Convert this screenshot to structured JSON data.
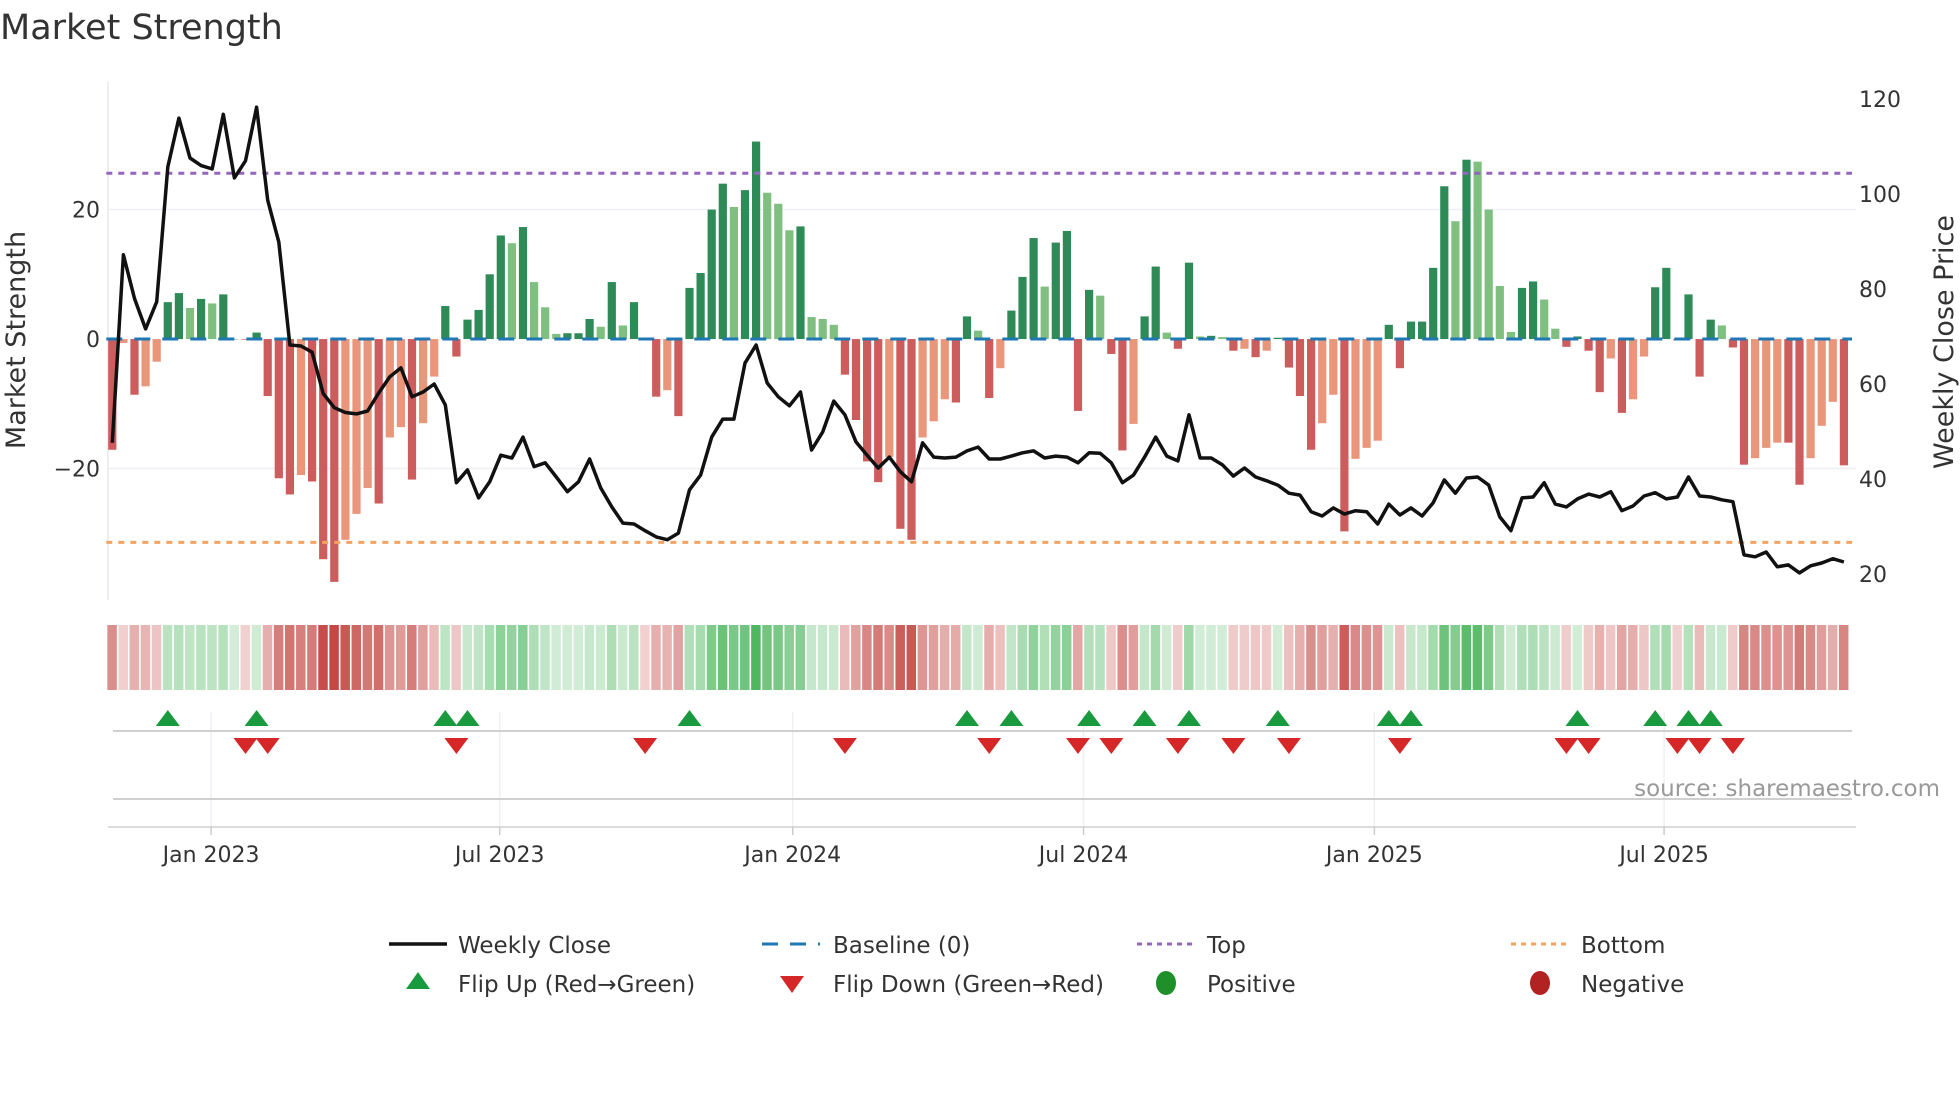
{
  "chart_data": {
    "type": "bar",
    "title": "Market Strength",
    "ylabel": "Market Strength",
    "y2label": "Weekly Close Price",
    "ylim": [
      -40.3,
      39.7
    ],
    "y2lim": [
      14.5,
      123.6
    ],
    "yticks": [
      "20",
      "0",
      "−20"
    ],
    "yticks_values": [
      20,
      0,
      -20
    ],
    "y2ticks": [
      "120",
      "100",
      "80",
      "60",
      "40",
      "20"
    ],
    "y2ticks_values": [
      120,
      100,
      80,
      60,
      40,
      20
    ],
    "xticks": [
      "Jan 2023",
      "Jul 2023",
      "Jan 2024",
      "Jul 2024",
      "Jan 2025",
      "Jul 2025"
    ],
    "top_level": 25.6,
    "bottom_level": -31.4,
    "baseline": 0,
    "strength": [
      -17.1,
      -0.6,
      -8.6,
      -7.3,
      -3.5,
      5.7,
      7.1,
      4.8,
      6.2,
      5.5,
      6.9,
      0,
      -0.1,
      1.0,
      -8.8,
      -21.5,
      -24,
      -21,
      -22,
      -34,
      -37.5,
      -31,
      -27,
      -23,
      -25.4,
      -15.2,
      -13.6,
      -21.7,
      -13,
      -5.8,
      5.1,
      -2.7,
      3.0,
      4.5,
      10,
      16,
      14.8,
      17.3,
      8.8,
      4.9,
      0.8,
      0.9,
      0.9,
      3.1,
      1.9,
      8.8,
      2.1,
      5.7,
      -0.1,
      -8.9,
      -7.9,
      -11.9,
      7.9,
      10.2,
      20,
      24,
      20.4,
      23,
      30.5,
      22.6,
      20.9,
      16.8,
      17.4,
      3.4,
      3.1,
      2.2,
      -5.5,
      -12.5,
      -18.9,
      -22.1,
      -18.2,
      -29.3,
      -31,
      -15.2,
      -12.7,
      -9.3,
      -9.8,
      3.5,
      1.3,
      -9.1,
      -4.5,
      4.4,
      9.6,
      15.6,
      8.1,
      14.9,
      16.7,
      -11.1,
      7.6,
      6.7,
      -2.3,
      -17.2,
      -13.1,
      3.5,
      11.2,
      1,
      -1.5,
      11.8,
      0.4,
      0.5,
      0.3,
      -1.8,
      -1.5,
      -2.8,
      -1.8,
      0.2,
      -4.4,
      -8.8,
      -17.1,
      -13,
      -8.6,
      -29.7,
      -18.5,
      -16.8,
      -15.7,
      2.2,
      -4.5,
      2.7,
      2.7,
      11,
      23.6,
      18.2,
      27.7,
      27.4,
      20,
      8.2,
      1.1,
      7.9,
      8.9,
      6.1,
      1.6,
      -1.2,
      0.4,
      -1.8,
      -8.2,
      -3,
      -11.4,
      -9.3,
      -2.7,
      8,
      11,
      -0.2,
      6.9,
      -5.8,
      3,
      2.1,
      -1.3,
      -19.4,
      -18.4,
      -16.8,
      -16,
      -16,
      -22.5,
      -18.4,
      -13.4,
      -9.7,
      -19.5
    ],
    "weekly_close": [
      47.6,
      87.2,
      78,
      71.6,
      77.3,
      105.7,
      116,
      107.6,
      106,
      105.3,
      116.8,
      103.4,
      107,
      118.3,
      98.7,
      89.9,
      68.2,
      68,
      66.7,
      58,
      55,
      54,
      53.7,
      54.3,
      58.1,
      61.5,
      63.4,
      57.3,
      58.3,
      60,
      55.6,
      39.2,
      41.9,
      36,
      39.4,
      45,
      44.4,
      48.8,
      42.6,
      43.4,
      40.4,
      37.3,
      39.4,
      44.2,
      38.1,
      34.1,
      30.7,
      30.5,
      29.1,
      27.8,
      27.2,
      28.6,
      37.7,
      40.8,
      48.8,
      52.6,
      52.6,
      64.4,
      68.2,
      60.2,
      57.3,
      55.4,
      58.3,
      46.1,
      49.9,
      56.4,
      53.5,
      47.8,
      45,
      42.3,
      44.6,
      41.5,
      39.4,
      47.6,
      44.6,
      44.4,
      44.6,
      45.9,
      46.7,
      44.2,
      44.2,
      44.8,
      45.5,
      45.9,
      44.4,
      44.8,
      44.6,
      43.4,
      45.5,
      45.4,
      43.4,
      39.2,
      40.8,
      44.6,
      48.8,
      44.8,
      43.8,
      53.5,
      44.4,
      44.4,
      43,
      40.6,
      42.3,
      40.4,
      39.6,
      38.7,
      37,
      36.6,
      33.1,
      32.2,
      33.9,
      32.6,
      33.3,
      33.1,
      30.5,
      34.7,
      32.4,
      33.9,
      32.2,
      35,
      39.8,
      37,
      40.2,
      40.4,
      38.7,
      32,
      29.1,
      36,
      36.2,
      39.2,
      34.7,
      34.1,
      35.8,
      36.8,
      36.2,
      37.3,
      33.3,
      34.3,
      36.4,
      37.1,
      35.8,
      36.2,
      40.4,
      36.4,
      36.2,
      35.6,
      35.2,
      24,
      23.6,
      24.6,
      21.5,
      21.9,
      20.2,
      21.7,
      22.3,
      23.2,
      22.5
    ],
    "flip_up_weeks": [
      5,
      13,
      30,
      32,
      52,
      77,
      81,
      88,
      93,
      97,
      105,
      115,
      117,
      132,
      139,
      142,
      144
    ],
    "flip_down_weeks": [
      12,
      14,
      31,
      48,
      66,
      79,
      87,
      90,
      96,
      101,
      106,
      116,
      131,
      133,
      141,
      143,
      146
    ],
    "legend": {
      "weekly_close": "Weekly Close",
      "baseline": "Baseline (0)",
      "top": "Top",
      "bottom": "Bottom",
      "flip_up": "Flip Up (Red→Green)",
      "flip_down": "Flip Down (Green→Red)",
      "positive": "Positive",
      "negative": "Negative"
    },
    "legend_placement": "bottom-center",
    "source": "source: sharemaestro.com"
  },
  "colors": {
    "pos_strong": "#2e8b57",
    "pos_weak": "#7fbf7f",
    "neg_strong": "#cd5c5c",
    "neg_weak": "#e9967a",
    "line": "#111111",
    "baseline": "#1f77b4",
    "top": "#9467bd",
    "bottom": "#f4a460",
    "flip_up": "#1a9a3e",
    "flip_down": "#d62728",
    "positive_dot": "#1f8f2a",
    "negative_dot": "#b22222"
  }
}
